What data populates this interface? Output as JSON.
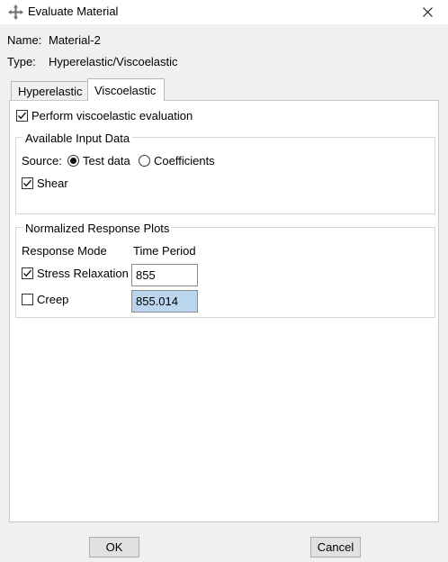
{
  "window": {
    "title": "Evaluate Material",
    "icon": "abaqus-cross-arrows-icon",
    "close_glyph": "✕"
  },
  "info": {
    "name_label": "Name:",
    "name_value": "Material-2",
    "type_label": "Type:",
    "type_value": "Hyperelastic/Viscoelastic"
  },
  "tabs": [
    {
      "label": "Hyperelastic",
      "active": false
    },
    {
      "label": "Viscoelastic",
      "active": true
    }
  ],
  "viscoelastic": {
    "perform_label": "Perform viscoelastic evaluation",
    "perform_checked": true,
    "input_group": {
      "title": "Available Input Data",
      "source_label": "Source:",
      "options": [
        {
          "label": "Test data",
          "selected": true
        },
        {
          "label": "Coefficients",
          "selected": false
        }
      ],
      "shear_label": "Shear",
      "shear_checked": true
    },
    "plots_group": {
      "title": "Normalized Response Plots",
      "col_mode": "Response Mode",
      "col_time": "Time Period",
      "rows": [
        {
          "label": "Stress Relaxation",
          "checked": true,
          "value": "855"
        },
        {
          "label": "Creep",
          "checked": false,
          "value": "855.014"
        }
      ]
    }
  },
  "buttons": {
    "ok": "OK",
    "cancel": "Cancel"
  },
  "colors": {
    "selected_field": "#bcd5ef",
    "dialog_bg": "#f0f0f0"
  }
}
